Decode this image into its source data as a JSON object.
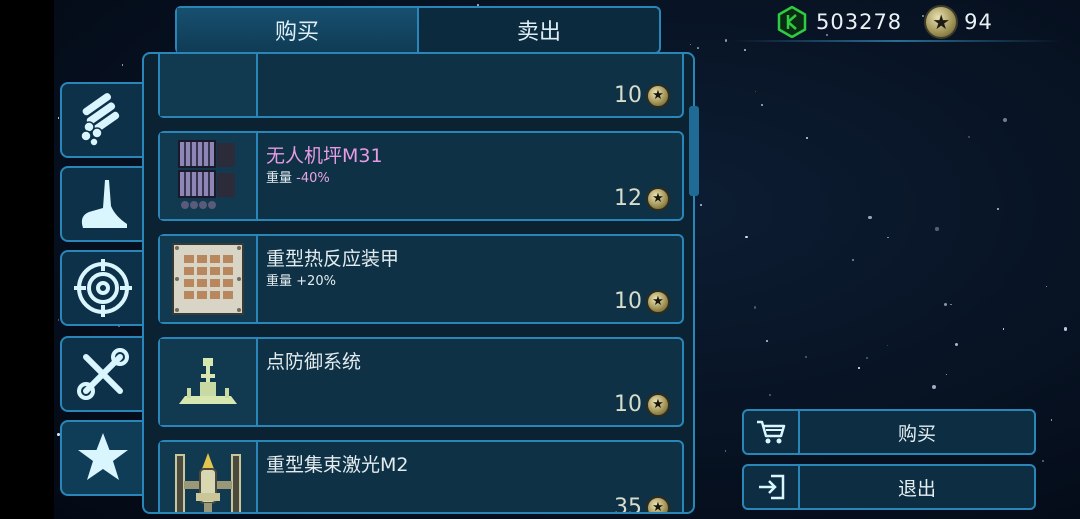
{
  "tabs": {
    "buy": "购买",
    "sell": "卖出",
    "active": "buy"
  },
  "currency": {
    "credits": "503278",
    "stars": "94"
  },
  "categories": [
    {
      "icon": "pipes-icon"
    },
    {
      "icon": "wing-icon"
    },
    {
      "icon": "crosshair-icon"
    },
    {
      "icon": "tools-icon"
    },
    {
      "icon": "star-icon"
    }
  ],
  "items": [
    {
      "name": "",
      "sub_label": "",
      "sub_value": "",
      "price": "10",
      "icon": "partial-item-icon"
    },
    {
      "name": "无人机坪M31",
      "sub_label": "重量",
      "sub_value": "-40%",
      "price": "12",
      "icon": "drone-bay-icon"
    },
    {
      "name": "重型热反应装甲",
      "sub_label": "重量",
      "sub_value": "+20%",
      "price": "10",
      "icon": "armor-plate-icon"
    },
    {
      "name": "点防御系统",
      "sub_label": "",
      "sub_value": "",
      "price": "10",
      "icon": "point-defense-icon"
    },
    {
      "name": "重型集束激光M2",
      "sub_label": "",
      "sub_value": "",
      "price": "35",
      "icon": "laser-turret-icon"
    }
  ],
  "actions": {
    "buy": "购买",
    "exit": "退出"
  },
  "colors": {
    "accent": "#2a86b8",
    "pink": "#e79be2",
    "gem": "#2ecc40"
  }
}
